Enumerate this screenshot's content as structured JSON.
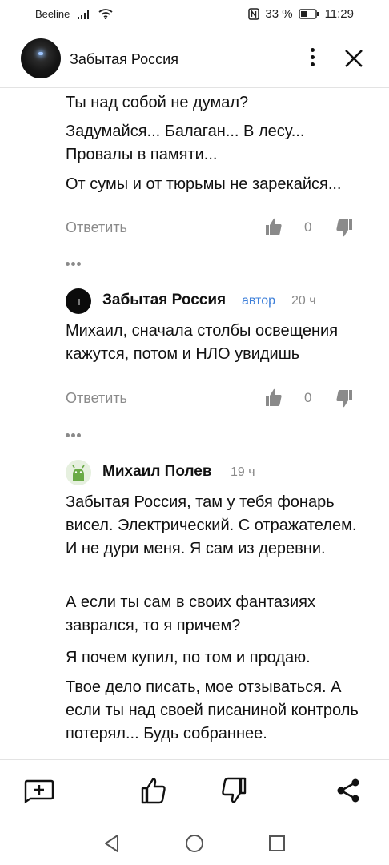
{
  "status_bar": {
    "carrier": "Beeline",
    "battery": "33 %",
    "time": "11:29",
    "icons": [
      "signal-icon",
      "wifi-icon",
      "nfc-icon",
      "battery-icon"
    ]
  },
  "header": {
    "title": "Забытая Россия",
    "icons": [
      "kebab-menu-icon",
      "close-icon"
    ]
  },
  "comments": {
    "first_tail": {
      "paragraphs": [
        "Ты над собой не думал?",
        "Задумайся... Балаган... В лесу... Провалы в памяти...",
        "От сумы и от тюрьмы не зарекайся..."
      ],
      "reply_label": "Ответить",
      "likes": "0"
    },
    "second": {
      "author": "Забытая Россия",
      "badge": "автор",
      "time": "20 ч",
      "paragraphs": [
        "Михаил, сначала столбы освещения кажутся, потом и НЛО увидишь"
      ],
      "reply_label": "Ответить",
      "likes": "0"
    },
    "third": {
      "author": "Михаил Полев",
      "time": "19 ч",
      "paragraphs": [
        "Забытая Россия, там у тебя фонарь висел. Электрический. С отражателем. И не дури меня. Я сам из деревни.",
        "А если ты сам в своих фантазиях заврался, то я причем?",
        "Я почем купил, по том и продаю.",
        "Твое дело писать, мое отзываться. А если ты над своей писаниной контроль потерял... Будь собраннее."
      ]
    }
  },
  "action_bar": {
    "icons": [
      "add-comment-icon",
      "like-icon",
      "dislike-icon",
      "share-icon"
    ]
  },
  "nav_bar": {
    "icons": [
      "back-icon",
      "home-icon",
      "recents-icon"
    ]
  }
}
